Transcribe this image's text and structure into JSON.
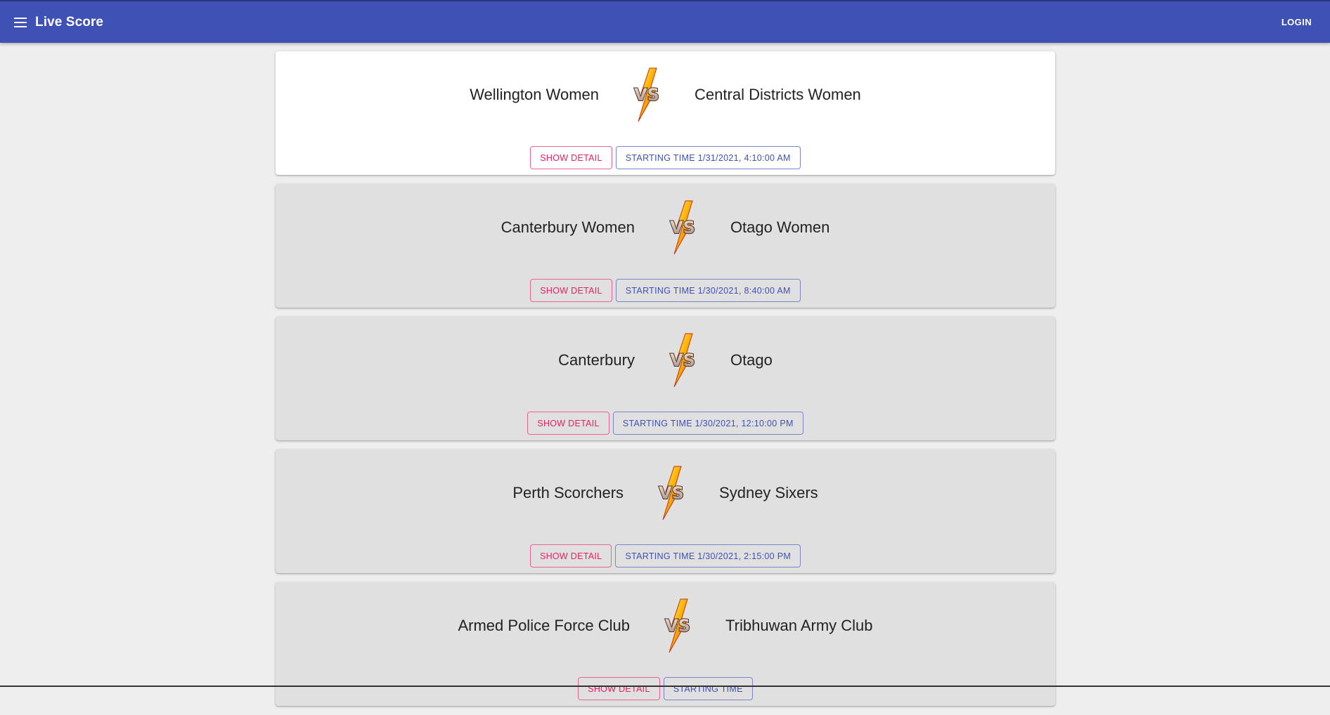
{
  "app": {
    "title": "Live Score",
    "login_label": "LOGIN",
    "menu_icon": "menu-icon",
    "header_color": "#3f51b5"
  },
  "matches": [
    {
      "team_a": "Wellington Women",
      "team_b": "Central Districts Women",
      "detail_label": "SHOW DETAIL",
      "time_label": "STARTING TIME 1/31/2021, 4:10:00 AM"
    },
    {
      "team_a": "Canterbury Women",
      "team_b": "Otago Women",
      "detail_label": "SHOW DETAIL",
      "time_label": "STARTING TIME 1/30/2021, 8:40:00 AM"
    },
    {
      "team_a": "Canterbury",
      "team_b": "Otago",
      "detail_label": "SHOW DETAIL",
      "time_label": "STARTING TIME 1/30/2021, 12:10:00 PM"
    },
    {
      "team_a": "Perth Scorchers",
      "team_b": "Sydney Sixers",
      "detail_label": "SHOW DETAIL",
      "time_label": "STARTING TIME 1/30/2021, 2:15:00 PM"
    },
    {
      "team_a": "Armed Police Force Club",
      "team_b": "Tribhuwan Army Club",
      "detail_label": "SHOW DETAIL",
      "time_label": "STARTING TIME"
    }
  ],
  "colors": {
    "detail_accent": "#e91e63",
    "time_accent": "#3f51b5",
    "card_active": "#ffffff",
    "card_inactive": "#e0e0e0"
  },
  "icons": {
    "versus": "vs-lightning-icon"
  }
}
